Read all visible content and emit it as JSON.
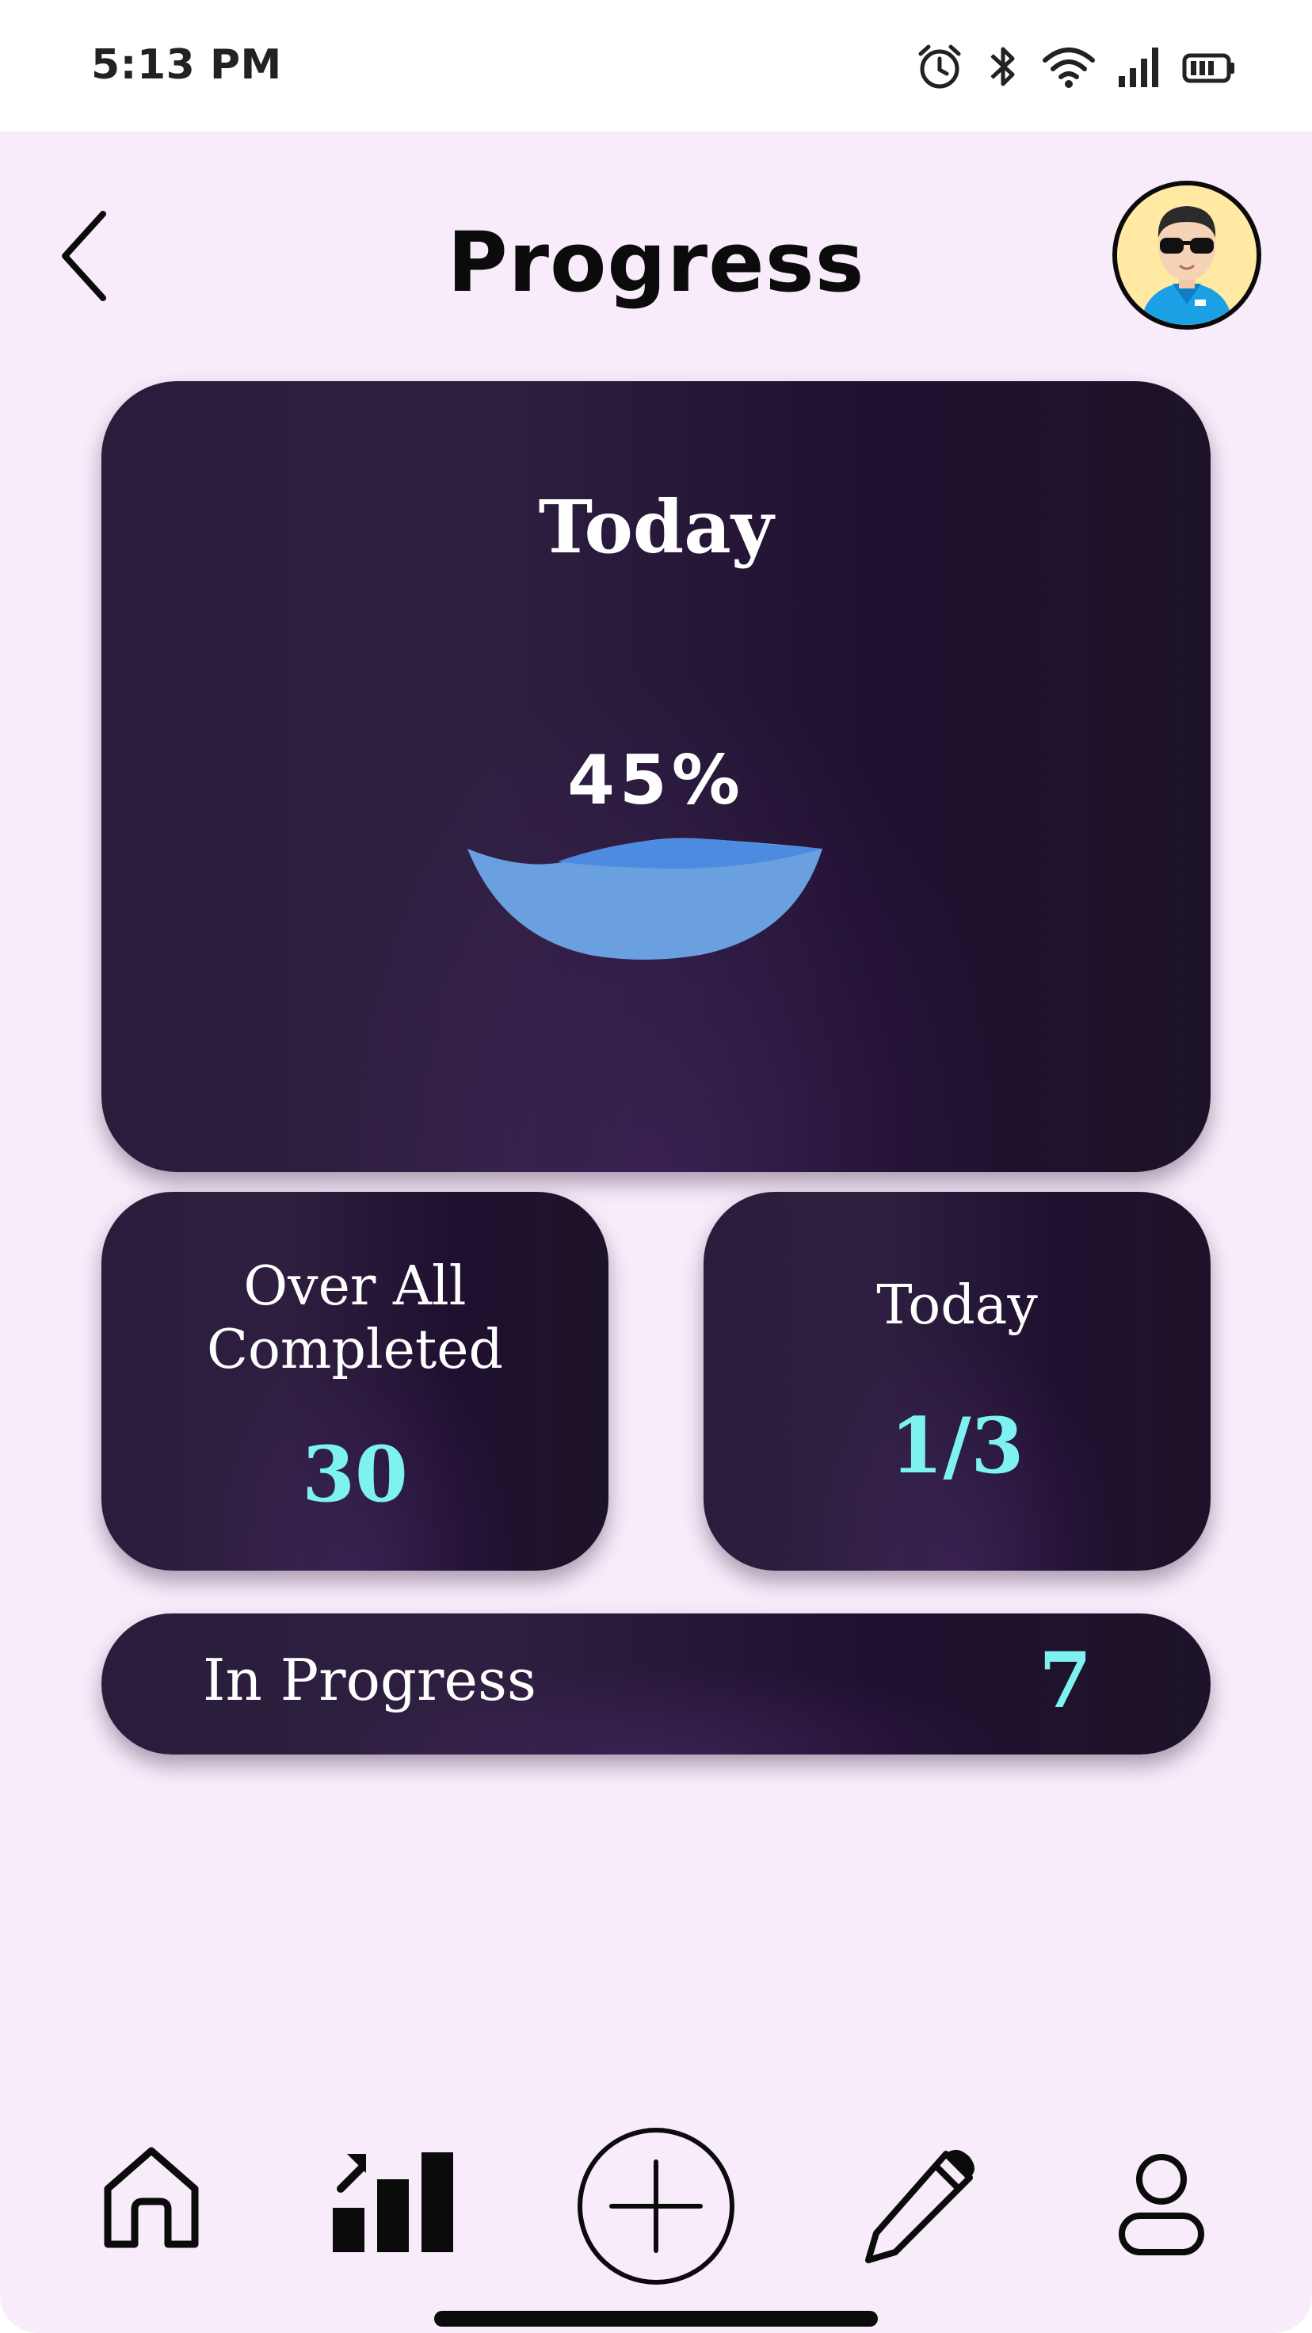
{
  "status_bar": {
    "time": "5:13 PM",
    "icons": [
      "alarm-icon",
      "bluetooth-icon",
      "wifi-icon",
      "signal-icon",
      "battery-icon"
    ]
  },
  "header": {
    "title": "Progress",
    "back_icon": "chevron-left-icon",
    "avatar": "user-avatar"
  },
  "today_card": {
    "title": "Today",
    "percent_label": "45%",
    "percent_value": 45,
    "fill_color": "#5b95e0"
  },
  "overall_card": {
    "label_line1": "Over All",
    "label_line2": "Completed",
    "value": "30"
  },
  "today_count_card": {
    "label": "Today",
    "value": "1/3"
  },
  "in_progress_card": {
    "label": "In Progress",
    "value": "7"
  },
  "bottom_nav": {
    "items": [
      {
        "icon": "home-icon"
      },
      {
        "icon": "stats-icon"
      },
      {
        "icon": "add-icon"
      },
      {
        "icon": "pencil-icon"
      },
      {
        "icon": "profile-icon"
      }
    ]
  },
  "colors": {
    "background": "#f8ecfb",
    "card": "#231631",
    "accent": "#7df2f0"
  }
}
